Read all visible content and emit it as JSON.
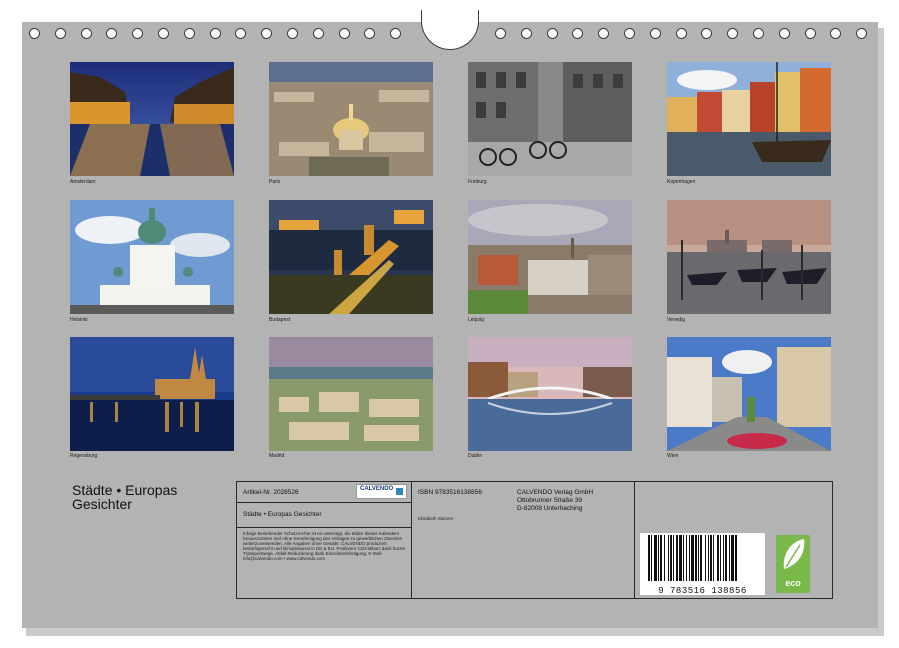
{
  "calendar": {
    "title": "Städte • Europas\nGesichter",
    "cities": [
      {
        "caption": "Amsterdam"
      },
      {
        "caption": "Paris"
      },
      {
        "caption": "Freiburg"
      },
      {
        "caption": "Kopenhagen"
      },
      {
        "caption": "Helsinki"
      },
      {
        "caption": "Budapest"
      },
      {
        "caption": "Leipzig"
      },
      {
        "caption": "Venedig"
      },
      {
        "caption": "Regensburg"
      },
      {
        "caption": "Madrid"
      },
      {
        "caption": "Dublin"
      },
      {
        "caption": "Wien"
      }
    ]
  },
  "imprint": {
    "article_no": "Artikel-Nr. 2028526",
    "publisher_logo": "CALVENDO",
    "product_title": "Städte • Europas Gesichter",
    "legal_text": "Infolge bestehender Schutzrechte ist es untersagt, die Bilder dieses Kalenders herauszulösen und ohne Genehmigung des Verlages zu gewerblichen Zwecken weiterzuverwenden. Alle Angaben ohne Gewähr. CALVENDO produziert bedarfsgerecht und klimabewusst in DE & EU. Positivere CO2-Bilanz dank kurzer Transportwege. Abfall-Reduzierung dank Einzelstückfertigung. E-Mail: info@calvendo.com • www.calvendo.com",
    "isbn": "ISBN 9783516138856",
    "author": "Elisabeth Stanzer",
    "publisher_name": "CALVENDO Verlag GmbH",
    "publisher_street": "Ottobrunner Straße 39",
    "publisher_city": "D-82008 Unterhaching",
    "barcode_digits": "9 783516 138856",
    "eco_label": "eco"
  }
}
